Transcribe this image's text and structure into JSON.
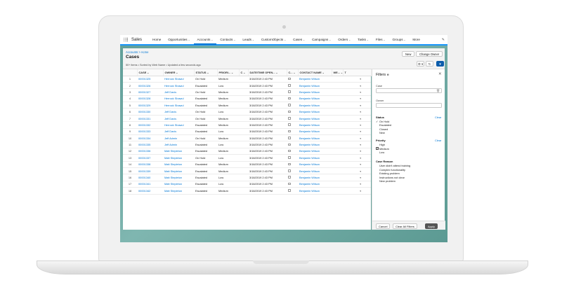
{
  "nav": {
    "app_name": "Sales",
    "items": [
      "Home",
      "Opportunities",
      "Accounts",
      "Contacts",
      "Leads",
      "CustomObjects",
      "Cases",
      "Campaigns",
      "Orders",
      "Tasks",
      "Files",
      "Groups",
      "More"
    ],
    "active": "Accounts"
  },
  "header": {
    "breadcrumb": "Accounts > Acme",
    "title": "Cases",
    "meta": "50+ items • Sorted by Web Name • Updated a few seconds ago",
    "new_label": "New",
    "change_owner_label": "Change Owner",
    "gear_glyph": "⚙ ▾",
    "refresh_glyph": "↻",
    "filter_glyph": "▼"
  },
  "table": {
    "columns": [
      "",
      "CASE",
      "OWNER",
      "STATUS",
      "PRIORI...",
      "C",
      "DATE/TIME OPEN...",
      "C...",
      "CONTACT NAME",
      "WE...",
      "T"
    ],
    "rows": [
      {
        "n": "1",
        "case": "00001325",
        "owner": "Herrock Shawul",
        "status": "On Hold",
        "priority": "Medium",
        "date": "3/18/2019 2:43 PM",
        "contact": "Benjamin Wilson"
      },
      {
        "n": "2",
        "case": "00001326",
        "owner": "Herrock Shawul",
        "status": "Escalated",
        "priority": "Low",
        "date": "3/18/2019 2:43 PM",
        "contact": "Benjamin Wilson"
      },
      {
        "n": "3",
        "case": "00001327",
        "owner": "Jeff Davis",
        "status": "On Hold",
        "priority": "Medium",
        "date": "3/18/2019 2:43 PM",
        "contact": "Benjamin Wilson"
      },
      {
        "n": "4",
        "case": "00001328",
        "owner": "Herrock Shawul",
        "status": "Escalated",
        "priority": "Medium",
        "date": "3/18/2019 2:43 PM",
        "contact": "Benjamin Wilson"
      },
      {
        "n": "5",
        "case": "00001329",
        "owner": "Herrock Shawul",
        "status": "Escalated",
        "priority": "Medium",
        "date": "3/18/2019 2:43 PM",
        "contact": "Benjamin Wilson"
      },
      {
        "n": "6",
        "case": "00001330",
        "owner": "Jeff Davis",
        "status": "On Hold",
        "priority": "Low",
        "date": "3/18/2019 2:43 PM",
        "contact": "Benjamin Wilson"
      },
      {
        "n": "7",
        "case": "00001331",
        "owner": "Jeff Davis",
        "status": "On Hold",
        "priority": "Medium",
        "date": "3/18/2019 2:43 PM",
        "contact": "Benjamin Wilson"
      },
      {
        "n": "8",
        "case": "00001332",
        "owner": "Herrock Shawul",
        "status": "Escalated",
        "priority": "Medium",
        "date": "3/18/2019 2:43 PM",
        "contact": "Benjamin Wilson"
      },
      {
        "n": "9",
        "case": "00001333",
        "owner": "Jeff Davis",
        "status": "Escalated",
        "priority": "Low",
        "date": "3/18/2019 2:43 PM",
        "contact": "Benjamin Wilson"
      },
      {
        "n": "10",
        "case": "00001334",
        "owner": "Jeff Admin",
        "status": "On Hold",
        "priority": "Medium",
        "date": "3/18/2019 2:43 PM",
        "contact": "Benjamin Wilson"
      },
      {
        "n": "11",
        "case": "00001335",
        "owner": "Jeff Admin",
        "status": "Escalated",
        "priority": "Low",
        "date": "3/18/2019 2:43 PM",
        "contact": "Benjamin Wilson"
      },
      {
        "n": "12",
        "case": "00001336",
        "owner": "Matt Stepleton",
        "status": "Escalated",
        "priority": "Medium",
        "date": "3/18/2019 2:43 PM",
        "contact": "Benjamin Wilson"
      },
      {
        "n": "13",
        "case": "00001337",
        "owner": "Matt Stepleton",
        "status": "On Hold",
        "priority": "Low",
        "date": "3/18/2019 2:43 PM",
        "contact": "Benjamin Wilson"
      },
      {
        "n": "14",
        "case": "00001338",
        "owner": "Matt Stepleton",
        "status": "Escalated",
        "priority": "Medium",
        "date": "3/18/2019 2:43 PM",
        "contact": "Benjamin Wilson"
      },
      {
        "n": "15",
        "case": "00001339",
        "owner": "Matt Stepleton",
        "status": "Escalated",
        "priority": "Medium",
        "date": "3/18/2019 2:43 PM",
        "contact": "Benjamin Wilson"
      },
      {
        "n": "16",
        "case": "00001340",
        "owner": "Matt Stepleton",
        "status": "Escalated",
        "priority": "Low",
        "date": "3/18/2019 2:43 PM",
        "contact": "Benjamin Wilson"
      },
      {
        "n": "17",
        "case": "00001341",
        "owner": "Matt Stepleton",
        "status": "Escalated",
        "priority": "Low",
        "date": "3/18/2019 2:43 PM",
        "contact": "Benjamin Wilson"
      },
      {
        "n": "18",
        "case": "00001342",
        "owner": "Matt Stepleton",
        "status": "Escalated",
        "priority": "Medium",
        "date": "3/18/2019 2:43 PM",
        "contact": "Benjamin Wilson"
      }
    ]
  },
  "filters": {
    "title": "Filters",
    "info_glyph": "❶",
    "close_glyph": "✕",
    "case_label": "Case",
    "owner_label": "Owner",
    "clear_label": "Clear",
    "status": {
      "label": "Status",
      "options": [
        "On Hold",
        "Escalated",
        "Closed",
        "New"
      ]
    },
    "priority": {
      "label": "Priority",
      "options": [
        "High",
        "Medium",
        "Low"
      ]
    },
    "case_reason": {
      "label": "Case Reason",
      "options": [
        "User didn't attend training",
        "Complex functionality",
        "Existing problem",
        "Instructions not clear",
        "New problem"
      ]
    },
    "cancel_label": "Cancel",
    "clear_all_label": "Clear All Filters",
    "apply_label": "Apply"
  },
  "colors": {
    "accent": "#0176d3",
    "brand_bg": "#6fa9a3"
  }
}
